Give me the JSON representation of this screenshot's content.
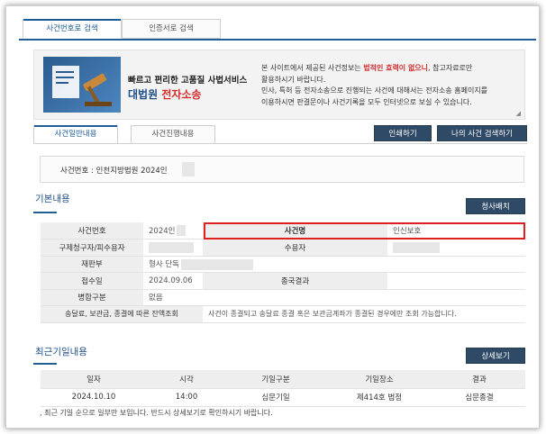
{
  "top_tabs": [
    "사건번호로 검색",
    "인증서로 검색"
  ],
  "banner": {
    "line1": "빠르고 편리한 고품질 사법서비스",
    "line2_a": "대법원",
    "line2_b": "전자소송",
    "notice_1a": "본 사이트에서 제공된 사건정보는 ",
    "notice_1b": "법적인 효력이 없으니",
    "notice_1c": ", 참고자료로만",
    "notice_2": "활용하시기 바랍니다.",
    "notice_3": "민사, 특허 등 전자소송으로 진행되는 사건에 대해서는 전자소송 홈페이지를",
    "notice_4": "이용하시면 판결문이나 사건기록을 모두 인터넷으로 보실 수 있습니다."
  },
  "content_tabs": [
    "사건일반내용",
    "사건진행내용"
  ],
  "buttons": {
    "print": "인쇄하기",
    "my_search": "나의 사건 검색하기",
    "claim": "청사배치",
    "detail": "상세보기"
  },
  "case_number_label": "사건번호 : 인천지방법원 2024인",
  "basic": {
    "title": "기본내용",
    "rows": [
      {
        "k1": "사건번호",
        "v1": "2024인",
        "k2": "사건명",
        "v2": "인신보호"
      },
      {
        "k1": "구제청구자/피수용자",
        "v1": "",
        "k2": "수용자",
        "v2": ""
      },
      {
        "k1": "재판부",
        "v1": "형사 단독"
      },
      {
        "k1": "접수일",
        "v1": "2024.09.06",
        "k2": "종국결과",
        "v2": ""
      },
      {
        "k1": "병합구분",
        "v1": "없음"
      },
      {
        "k1": "송달료, 보관금, 종결에 따른 잔액조회",
        "v1": "사건이 종결되고 송달료 종결 혹은 보관금계좌가 종결된 경우에만 조회 가능합니다."
      }
    ]
  },
  "recent": {
    "title": "최근기일내용",
    "headers": [
      "일자",
      "시각",
      "기일구분",
      "기일장소",
      "결과"
    ],
    "rows": [
      [
        "2024.10.10",
        "14:00",
        "심문기일",
        "제414호 법정",
        "심문종결"
      ]
    ],
    "footnote": "최근 기일 순으로 일부만 보입니다. 반드시 상세보기로 확인하시기 바랍니다."
  },
  "colors": {
    "accent": "#1f5e96",
    "dark_button": "#2e4a66",
    "highlight": "#e02020"
  }
}
